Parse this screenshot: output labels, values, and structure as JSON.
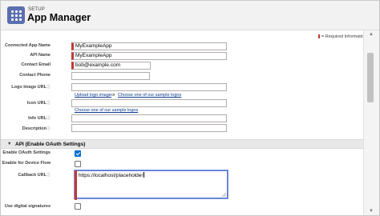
{
  "header": {
    "breadcrumb": "SETUP",
    "title": "App Manager",
    "icon": "grid-app-icon"
  },
  "required_note": "= Required Information",
  "fields": {
    "connected_app_name": {
      "label": "Connected App Name",
      "value": "MyExampleApp"
    },
    "api_name": {
      "label": "API Name",
      "value": "MyExampleApp"
    },
    "contact_email": {
      "label": "Contact Email",
      "value": "bob@example.com"
    },
    "contact_phone": {
      "label": "Contact Phone",
      "value": ""
    },
    "logo_image_url": {
      "label": "Logo Image URL",
      "value": ""
    },
    "icon_url": {
      "label": "Icon URL",
      "value": ""
    },
    "info_url": {
      "label": "Info URL",
      "value": ""
    },
    "description": {
      "label": "Description",
      "value": ""
    }
  },
  "logo_links": {
    "upload": "Upload logo image",
    "or": "or",
    "choose": "Choose one of our sample logos"
  },
  "icon_link": "Choose one of our sample logos",
  "api_section": {
    "title": "API (Enable OAuth Settings)",
    "enable_oauth": {
      "label": "Enable OAuth Settings",
      "checked": true
    },
    "device_flow": {
      "label": "Enable for Device Flow",
      "checked": false
    },
    "callback_url": {
      "label": "Callback URL",
      "value": "https://localhost/placeholder"
    },
    "digital_signatures": {
      "label": "Use digital signatures",
      "checked": false
    }
  },
  "colors": {
    "required_bar": "#c23934",
    "link": "#0b3c8e",
    "checkbox_on": "#0070d2",
    "app_icon": "#5a6fae"
  }
}
